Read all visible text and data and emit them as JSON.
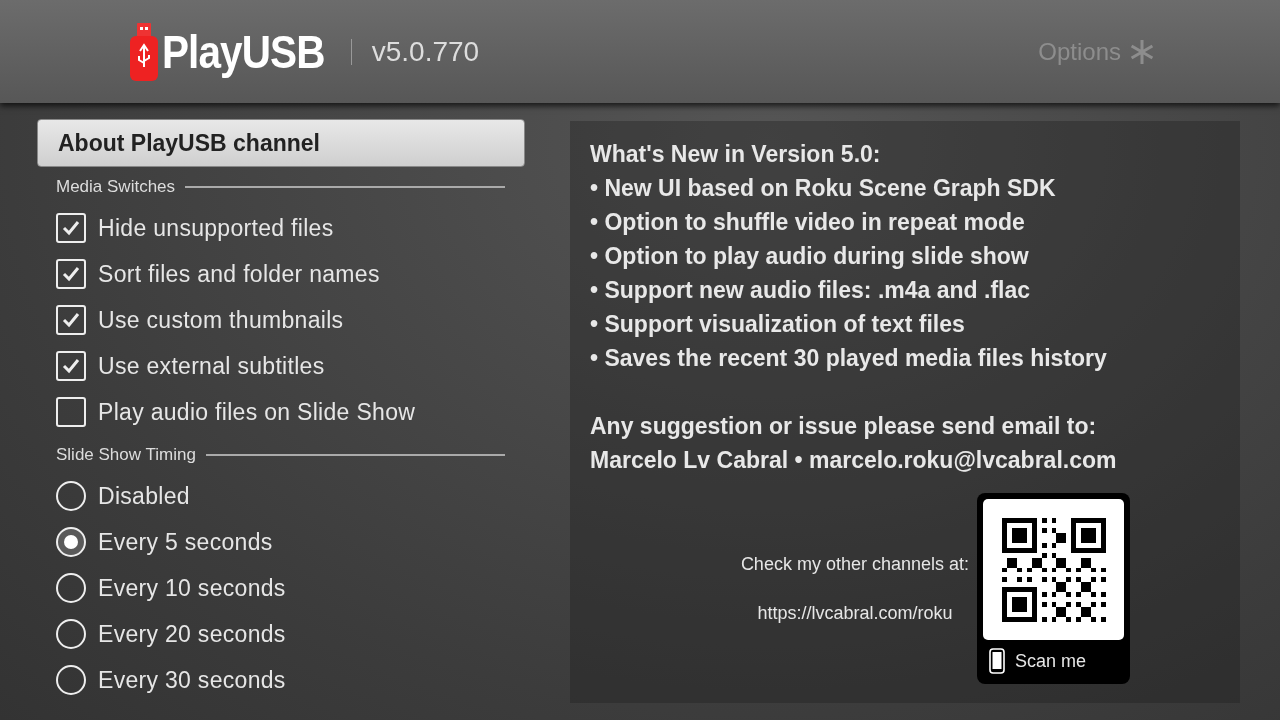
{
  "header": {
    "logo_text": "PlayUSB",
    "version": "v5.0.770",
    "options": "Options"
  },
  "menu": [
    {
      "label": "About PlayUSB channel",
      "selected": true
    }
  ],
  "sections": [
    {
      "title": "Media Switches",
      "kind": "checkbox",
      "items": [
        {
          "label": "Hide unsupported files",
          "checked": true
        },
        {
          "label": "Sort files and folder names",
          "checked": true
        },
        {
          "label": "Use custom thumbnails",
          "checked": true
        },
        {
          "label": "Use external subtitles",
          "checked": true
        },
        {
          "label": "Play audio files on Slide Show",
          "checked": false
        }
      ]
    },
    {
      "title": "Slide Show Timing",
      "kind": "radio",
      "items": [
        {
          "label": "Disabled",
          "selected": false
        },
        {
          "label": "Every 5 seconds",
          "selected": true
        },
        {
          "label": "Every 10 seconds",
          "selected": false
        },
        {
          "label": "Every 20 seconds",
          "selected": false
        },
        {
          "label": "Every 30 seconds",
          "selected": false
        }
      ]
    }
  ],
  "info": {
    "news": [
      "What's New in Version 5.0:",
      "• New UI based on Roku Scene Graph SDK",
      "• Option to shuffle video in repeat mode",
      "• Option to play audio during slide show",
      "• Support new audio files: .m4a and .flac",
      "• Support visualization of text files",
      "• Saves the recent 30 played media files history"
    ],
    "contact": [
      "Any suggestion or issue please send email to:",
      "Marcelo Lv Cabral • marcelo.roku@lvcabral.com"
    ],
    "channels_label": "Check my other channels at:",
    "url": "https://lvcabral.com/roku",
    "qr_caption": "Scan me"
  }
}
